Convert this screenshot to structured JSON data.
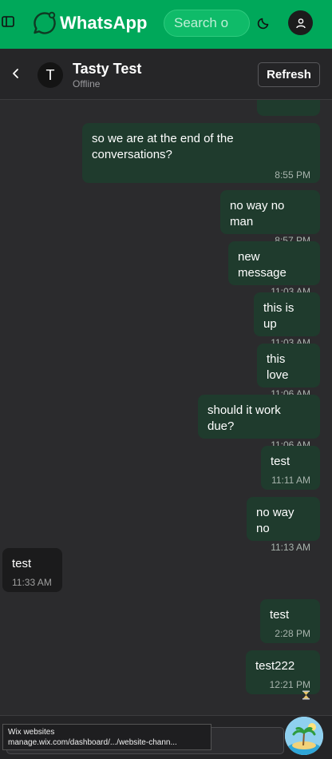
{
  "topbar": {
    "brand": "WhatsApp",
    "search_placeholder": "Search o",
    "accent": "#00a85a"
  },
  "chat_header": {
    "avatar_letter": "T",
    "contact_name": "Tasty Test",
    "status": "Offline",
    "refresh_label": "Refresh"
  },
  "messages": [
    {
      "direction": "outgoing",
      "text": "so we are at the end of the conversations?",
      "time": "8:55 PM"
    },
    {
      "direction": "outgoing",
      "text": "no way no man",
      "time": "8:57 PM"
    },
    {
      "direction": "outgoing",
      "text": "new message",
      "time": "11:03 AM"
    },
    {
      "direction": "outgoing",
      "text": "this is up",
      "time": "11:03 AM"
    },
    {
      "direction": "outgoing",
      "text": "this love",
      "time": "11:06 AM"
    },
    {
      "direction": "outgoing",
      "text": "should it work due?",
      "time": "11:06 AM"
    },
    {
      "direction": "outgoing",
      "text": "test",
      "time": "11:11 AM"
    },
    {
      "direction": "outgoing",
      "text": "no way no",
      "time": "11:13 AM"
    },
    {
      "direction": "incoming",
      "text": "test",
      "time": "11:33 AM"
    },
    {
      "direction": "outgoing",
      "text": "test",
      "time": "2:28 PM"
    },
    {
      "direction": "outgoing",
      "text": "test222",
      "time": "12:21 PM",
      "pending_icon": "hourglass-icon"
    }
  ],
  "status_tooltip": {
    "title": "Wix websites",
    "url": "manage.wix.com/dashboard/.../website-chann..."
  },
  "icons": {
    "sidebar": "sidebar-toggle-icon",
    "logo": "whatsapp-logo-icon",
    "theme": "moon-icon",
    "account": "user-icon",
    "back": "chevron-left-icon",
    "pending": "hourglass-icon"
  },
  "colors": {
    "outgoing_bubble": "#1f3b2d",
    "incoming_bubble": "#1b1b1c",
    "background": "#2b2b2d"
  }
}
